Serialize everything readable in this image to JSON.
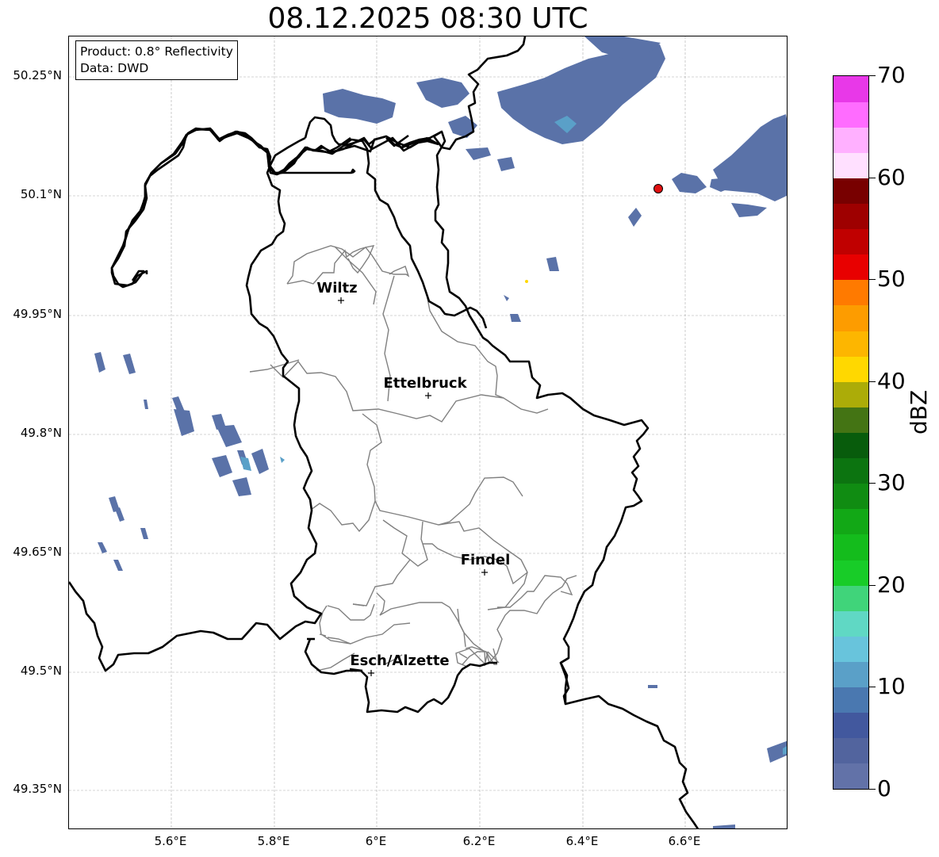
{
  "title": "08.12.2025 08:30 UTC",
  "info": {
    "product": "Product: 0.8° Reflectivity",
    "data": "Data: DWD"
  },
  "y_ticks": [
    "50.25°N",
    "50.1°N",
    "49.95°N",
    "49.8°N",
    "49.65°N",
    "49.5°N",
    "49.35°N"
  ],
  "x_ticks": [
    "5.6°E",
    "5.8°E",
    "6°E",
    "6.2°E",
    "6.4°E",
    "6.6°E"
  ],
  "cities": [
    "Wiltz",
    "Ettelbruck",
    "Findel",
    "Esch/Alzette"
  ],
  "colorbar": {
    "label": "dBZ",
    "ticks": [
      "0",
      "10",
      "20",
      "30",
      "40",
      "50",
      "60",
      "70"
    ],
    "colors": [
      "#6272a8",
      "#52649e",
      "#42589e",
      "#4a78b0",
      "#5aa0c8",
      "#68c4dc",
      "#60d8c4",
      "#40d47a",
      "#18cc28",
      "#14bc1c",
      "#12a816",
      "#108c12",
      "#0c7410",
      "#085c0c",
      "#447414",
      "#acac08",
      "#ffd800",
      "#fdb600",
      "#fd9c00",
      "#ff7a00",
      "#e80000",
      "#c00000",
      "#9e0000",
      "#780000",
      "#ffe0ff",
      "#ffb0ff",
      "#ff6cff",
      "#e838e8"
    ]
  }
}
